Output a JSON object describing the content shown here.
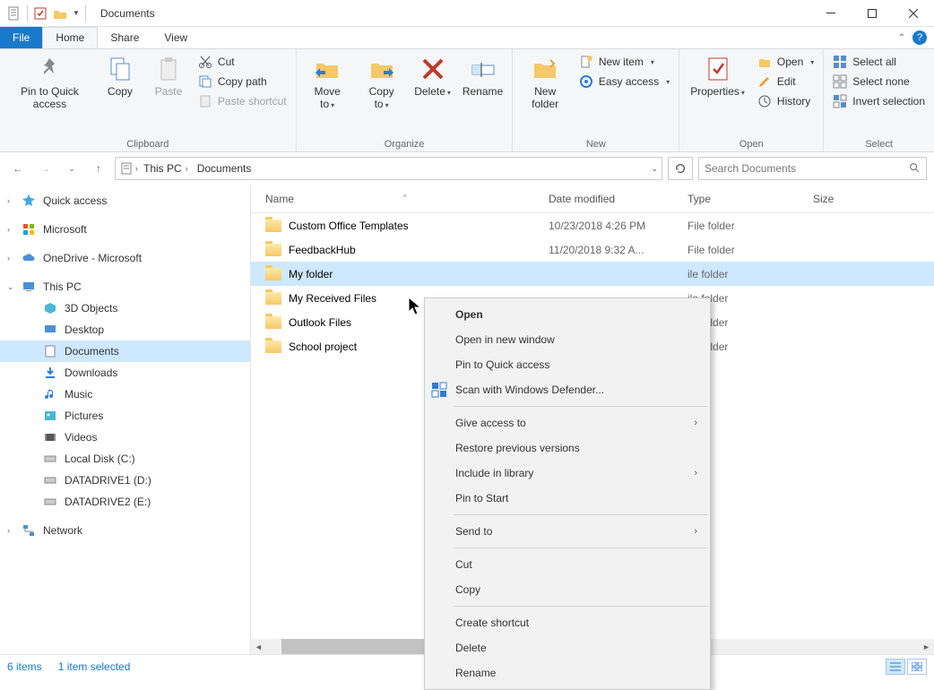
{
  "title": "Documents",
  "tabs": {
    "file": "File",
    "home": "Home",
    "share": "Share",
    "view": "View"
  },
  "ribbon": {
    "clipboard": {
      "label": "Clipboard",
      "pin": "Pin to Quick access",
      "copy": "Copy",
      "paste": "Paste",
      "cut": "Cut",
      "copypath": "Copy path",
      "pasteshortcut": "Paste shortcut"
    },
    "organize": {
      "label": "Organize",
      "moveto": "Move to",
      "copyto": "Copy to",
      "delete": "Delete",
      "rename": "Rename"
    },
    "new": {
      "label": "New",
      "newfolder": "New folder",
      "newitem": "New item",
      "easyaccess": "Easy access"
    },
    "open": {
      "label": "Open",
      "properties": "Properties",
      "open": "Open",
      "edit": "Edit",
      "history": "History"
    },
    "select": {
      "label": "Select",
      "all": "Select all",
      "none": "Select none",
      "invert": "Invert selection"
    }
  },
  "breadcrumb": {
    "seg1": "This PC",
    "seg2": "Documents"
  },
  "search_placeholder": "Search Documents",
  "nav": {
    "quick": "Quick access",
    "microsoft": "Microsoft",
    "onedrive": "OneDrive - Microsoft",
    "thispc": "This PC",
    "obj3d": "3D Objects",
    "desktop": "Desktop",
    "documents": "Documents",
    "downloads": "Downloads",
    "music": "Music",
    "pictures": "Pictures",
    "videos": "Videos",
    "localc": "Local Disk (C:)",
    "dd1": "DATADRIVE1 (D:)",
    "dd2": "DATADRIVE2 (E:)",
    "network": "Network"
  },
  "cols": {
    "name": "Name",
    "date": "Date modified",
    "type": "Type",
    "size": "Size"
  },
  "rows": [
    {
      "name": "Custom Office Templates",
      "date": "10/23/2018 4:26 PM",
      "type": "File folder"
    },
    {
      "name": "FeedbackHub",
      "date": "11/20/2018 9:32 A...",
      "type": "File folder"
    },
    {
      "name": "My folder",
      "date": "",
      "type": "ile folder",
      "selected": true
    },
    {
      "name": "My Received Files",
      "date": "",
      "type": "ile folder"
    },
    {
      "name": "Outlook Files",
      "date": "",
      "type": "ile folder"
    },
    {
      "name": "School project",
      "date": "",
      "type": "ile folder"
    }
  ],
  "context": {
    "open": "Open",
    "opennew": "Open in new window",
    "pinquick": "Pin to Quick access",
    "scan": "Scan with Windows Defender...",
    "giveaccess": "Give access to",
    "restore": "Restore previous versions",
    "include": "Include in library",
    "pinstart": "Pin to Start",
    "sendto": "Send to",
    "cut": "Cut",
    "copy": "Copy",
    "shortcut": "Create shortcut",
    "delete": "Delete",
    "rename": "Rename"
  },
  "status": {
    "items": "6 items",
    "selected": "1 item selected"
  }
}
